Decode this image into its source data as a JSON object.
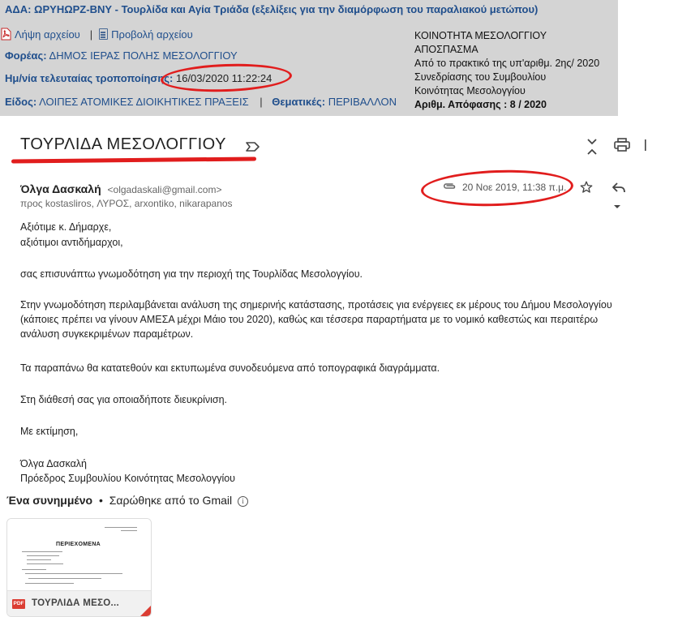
{
  "panel": {
    "ada_title": "ΑΔΑ: ΩΡΥΗΩΡΖ-ΒΝΥ - Τουρλίδα και Αγία Τριάδα (εξελίξεις για την διαμόρφωση του παραλιακού μετώπου)",
    "download_label": "Λήψη αρχείου",
    "view_label": "Προβολή αρχείου",
    "separator": "|",
    "foreas_label": "Φορέας:",
    "foreas_value": "ΔΗΜΟΣ ΙΕΡΑΣ ΠΟΛΗΣ ΜΕΣΟΛΟΓΓΙΟΥ",
    "date_label": "Ημ/νία τελευταίας τροποποίησης:",
    "date_value": "16/03/2020 11:22:24",
    "eidos_label": "Είδος:",
    "eidos_value": "ΛΟΙΠΕΣ ΑΤΟΜΙΚΕΣ ΔΙΟΙΚΗΤΙΚΕΣ ΠΡΑΞΕΙΣ",
    "thematikes_label": "Θεματικές:",
    "thematikes_value": "ΠΕΡΙΒΑΛΛΟΝ",
    "right_lines": [
      "ΚΟΙΝΟΤΗΤΑ ΜΕΣΟΛΟΓΓΙΟΥ",
      "ΑΠΟΣΠΑΣΜΑ",
      "Από το πρακτικό της υπ'αριθμ. 2ης/ 2020",
      "Συνεδρίασης του Συμβουλίου",
      "Κοινότητας Μεσολογγίου"
    ],
    "decision_label": "Αριθμ. Απόφασης : 8 / 2020"
  },
  "email": {
    "subject": "ΤΟΥΡΛΙΔΑ ΜΕΣΟΛΟΓΓΙΟΥ",
    "sender_name": "Όλγα Δασκαλή",
    "sender_email": "<olgadaskali@gmail.com>",
    "recipients": "προς kostasliros, ΛΥΡΟΣ, arxontiko, nikarapanos",
    "date": "20 Νοε 2019, 11:38 π.μ.",
    "body": [
      "Αξιότιμε κ. Δήμαρχε,",
      "αξιότιμοι αντιδήμαρχοι,",
      "σας επισυνάπτω γνωμοδότηση για την περιοχή της Τουρλίδας Μεσολογγίου.",
      "Στην γνωμοδότηση περιλαμβάνεται ανάλυση της σημερινής κατάστασης, προτάσεις για ενέργειες εκ μέρους του Δήμου Μεσολογγίου",
      "(κάποιες πρέπει να γίνουν ΑΜΕΣΑ μέχρι Μάιο του 2020),  καθώς και τέσσερα παραρτήματα με το νομικό καθεστώς και περαιτέρω",
      "ανάλυση συγκεκριμένων παραμέτρων.",
      "Τα παραπάνω θα κατατεθούν και εκτυπωμένα συνοδευόμενα από τοπογραφικά διαγράμματα.",
      "Στη διάθεσή σας για οποιαδήποτε διευκρίνιση.",
      "Με εκτίμηση,",
      "Όλγα Δασκαλή",
      "Πρόεδρος Συμβουλίου Κοινότητας Μεσολογγίου"
    ],
    "attachments_count_label": "Ένα συνημμένο",
    "bullet": "•",
    "scanned_label": "Σαρώθηκε από το Gmail",
    "attachment": {
      "heading": "ΠΕΡΙΕΧΟΜΕΝΑ",
      "badge": "PDF",
      "name": "ΤΟΥΡΛΙΔΑ ΜΕΣΟ..."
    }
  },
  "icons": {
    "pdf": "pdf-file-icon",
    "view": "document-icon",
    "label": "label-icon",
    "collapse": "expand-collapse-icon",
    "print": "print-icon",
    "attachment": "paperclip-icon",
    "star": "star-icon",
    "reply": "reply-icon",
    "more": "chevron-down-icon",
    "info": "info-icon"
  },
  "colors": {
    "panel_bg": "#d4d4d4",
    "link_blue": "#1f4e8c",
    "highlight_red": "#e11d1d",
    "pdf_red": "#db3d33"
  }
}
